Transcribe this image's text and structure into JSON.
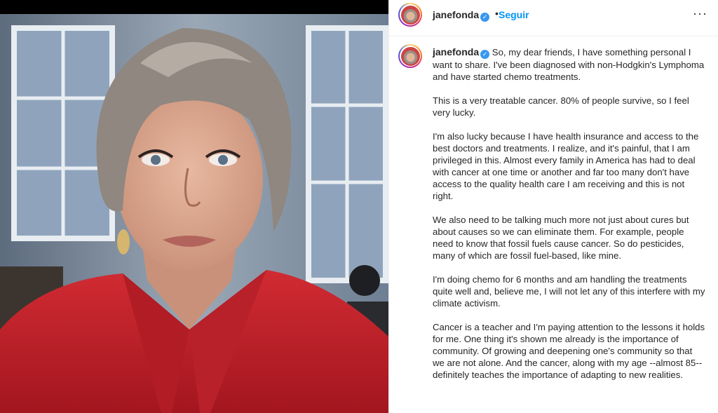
{
  "header": {
    "username": "janefonda",
    "verified_icon": "verified-badge-icon",
    "separator": "•",
    "follow_label": "Seguir",
    "more_icon": "more-options-icon",
    "more_label": "···"
  },
  "caption": {
    "username": "janefonda",
    "paragraphs": [
      "So, my dear friends, I have something personal I want to share. I've been diagnosed with non-Hodgkin's Lymphoma and have started chemo treatments.",
      "This is a very treatable cancer. 80% of people survive, so I feel very lucky.",
      "I'm also lucky because I have health insurance and access to the best doctors and treatments. I realize, and it's painful, that I am privileged in this. Almost every family in America has had to deal with cancer at one time or another and far too many don't have access to the quality health care I am receiving and this is not right.",
      "We also need to be talking much more not just about cures but about causes so we can eliminate them. For example, people need to know that fossil fuels cause cancer. So do pesticides, many of which are fossil fuel-based, like mine.",
      "I'm doing chemo for 6 months and am handling the treatments quite well and, believe me, I will not let any of this interfere with my climate activism.",
      "Cancer is a teacher and I'm paying attention to the lessons it holds for me. One thing it's shown me already is the importance of community. Of growing and deepening one's community so that we are not alone. And the cancer, along with my age --almost 85-- definitely teaches the importance of adapting to new realities."
    ]
  },
  "colors": {
    "follow": "#0095f6",
    "verified": "#3897f0",
    "jacket": "#c8202a"
  }
}
